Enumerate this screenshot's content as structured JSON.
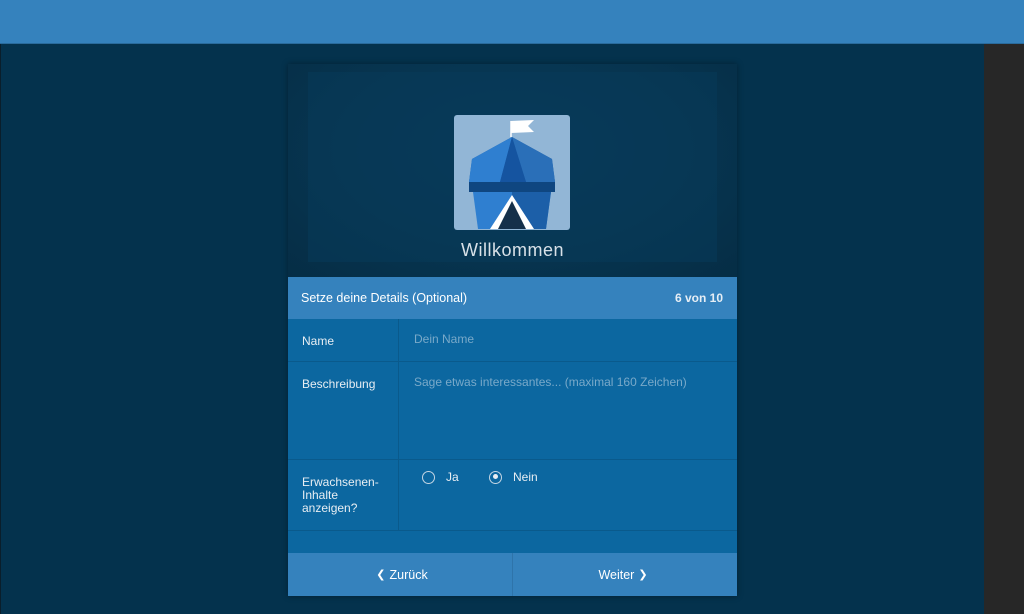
{
  "dialog": {
    "welcome": "Willkommen",
    "header_title": "Setze deine Details (Optional)",
    "step": "6 von 10"
  },
  "form": {
    "name_label": "Name",
    "name_placeholder": "Dein Name",
    "desc_label": "Beschreibung",
    "desc_placeholder": "Sage etwas interessantes... (maximal 160 Zeichen)",
    "adult_label": "Erwachsenen-Inhalte anzeigen?",
    "option_yes": "Ja",
    "option_no": "Nein",
    "selected": "Nein"
  },
  "footer": {
    "back_label": "Zurück",
    "next_label": "Weiter"
  },
  "icons": {
    "logo": "openbazaar-tent-logo",
    "back": "chevron-left-icon",
    "next": "chevron-right-icon"
  },
  "colors": {
    "topbar": "#3582bd",
    "background": "#04324d",
    "form": "#0c67a0",
    "accent": "#3582bd"
  }
}
